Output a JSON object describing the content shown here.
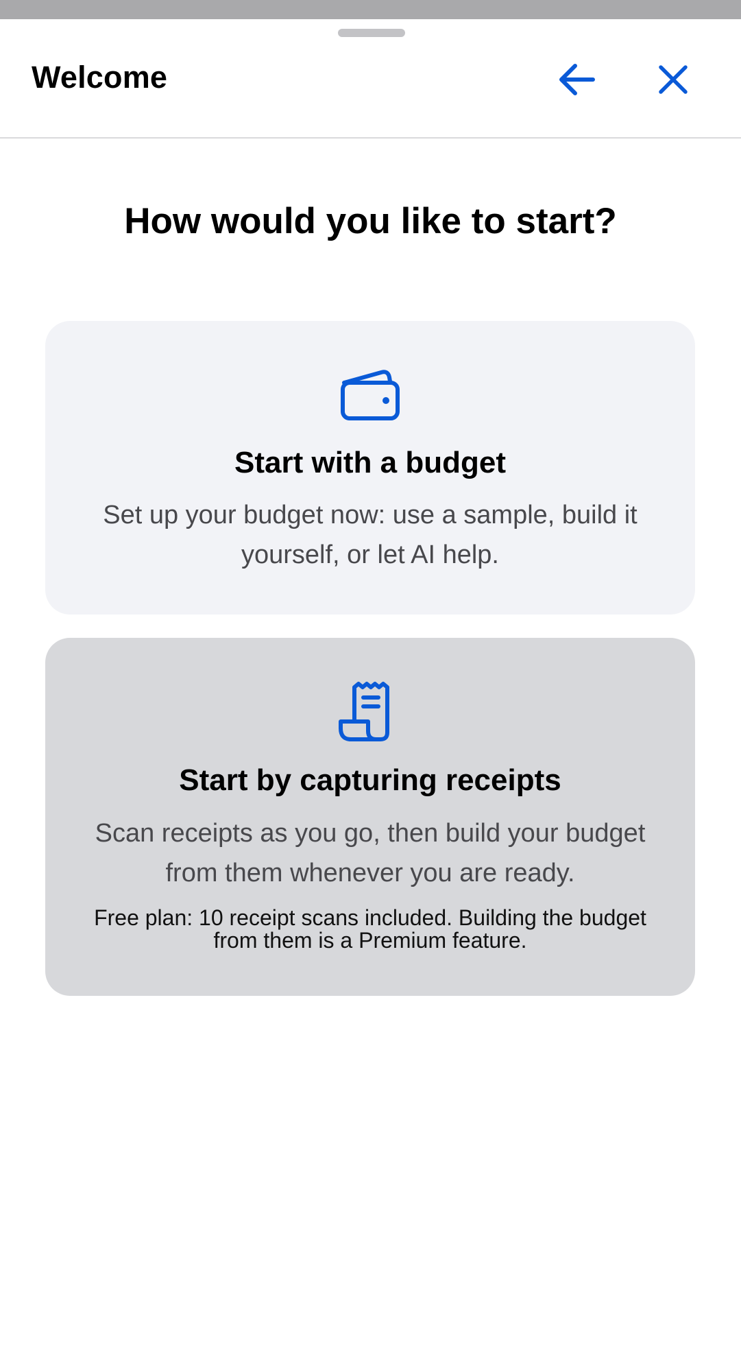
{
  "header": {
    "title": "Welcome",
    "back_icon": "arrow-left-icon",
    "close_icon": "close-icon"
  },
  "main": {
    "title": "How would you like to start?",
    "options": [
      {
        "icon": "wallet-icon",
        "title": "Start with a budget",
        "description": "Set up your budget now: use a sample, build it yourself, or let AI help."
      },
      {
        "icon": "receipt-icon",
        "title": "Start by capturing receipts",
        "description": "Scan receipts as you go, then build your budget from them whenever you are ready.",
        "note": "Free plan: 10 receipt scans included. Building the budget from them is a Premium feature."
      }
    ]
  },
  "colors": {
    "accent": "#0a5ad7",
    "card_default": "#f2f3f7",
    "card_selected": "#d7d8db",
    "secondary_text": "#48484c"
  }
}
